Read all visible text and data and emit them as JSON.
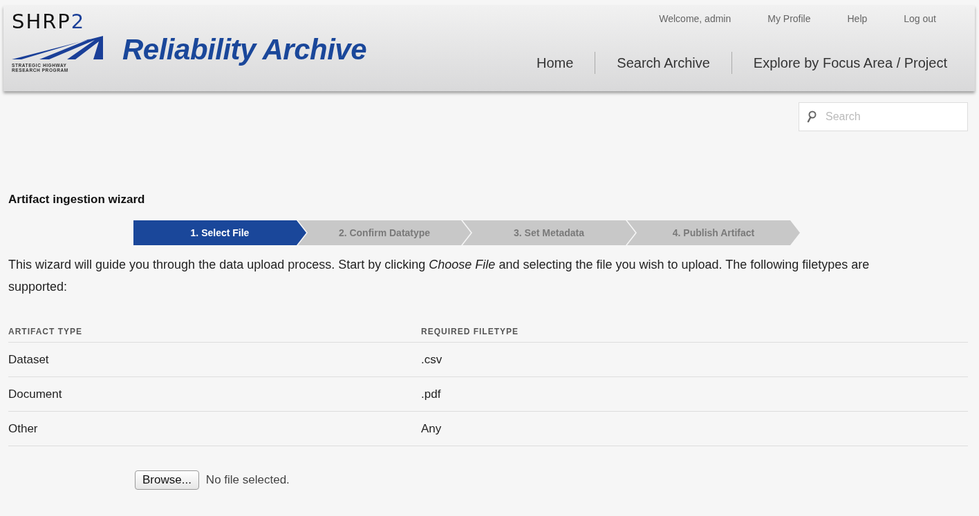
{
  "header": {
    "logo": {
      "mark": "SHRP",
      "mark_digit": "2",
      "tagline_1": "STRATEGIC HIGHWAY",
      "tagline_2": "RESEARCH PROGRAM"
    },
    "site_title": "Reliability Archive",
    "user_links": [
      "Welcome, admin",
      "My Profile",
      "Help",
      "Log out"
    ],
    "nav": [
      "Home",
      "Search Archive",
      "Explore by Focus Area / Project"
    ]
  },
  "search": {
    "placeholder": "Search"
  },
  "wizard": {
    "title": "Artifact ingestion wizard",
    "steps": [
      {
        "label": "1. Select File",
        "selected": true
      },
      {
        "label": "2. Confirm Datatype",
        "selected": false
      },
      {
        "label": "3. Set Metadata",
        "selected": false
      },
      {
        "label": "4. Publish Artifact",
        "selected": false
      }
    ],
    "intro": "This wizard will guide you through the data upload process. Start by clicking *Choose File* and selecting the file you wish to upload. The following filetypes are supported:"
  },
  "table": {
    "columns": [
      "ARTIFACT TYPE",
      "REQUIRED FILETYPE"
    ],
    "rows": [
      [
        "Dataset",
        ".csv"
      ],
      [
        "Document",
        ".pdf"
      ],
      [
        "Other",
        "Any"
      ]
    ]
  },
  "file_input": {
    "button": "Browse...",
    "status": "No file selected."
  }
}
